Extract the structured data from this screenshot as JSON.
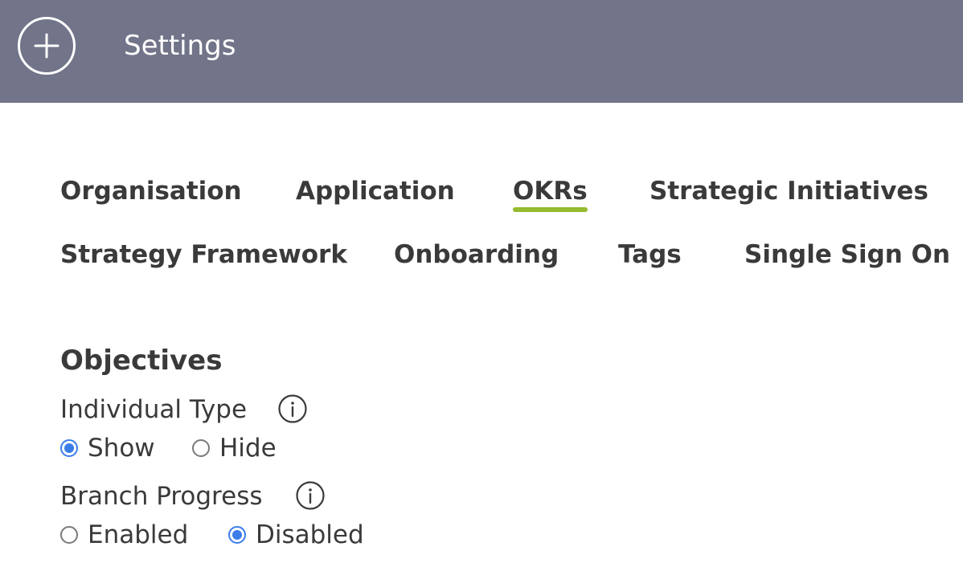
{
  "header": {
    "title": "Settings",
    "add_icon": "plus-circle-icon",
    "background": "#727489"
  },
  "tabs": [
    {
      "label": "Organisation",
      "active": false
    },
    {
      "label": "Application",
      "active": false
    },
    {
      "label": "OKRs",
      "active": true
    },
    {
      "label": "Strategic Initiatives",
      "active": false
    },
    {
      "label": "Strategy Framework",
      "active": false
    },
    {
      "label": "Onboarding",
      "active": false
    },
    {
      "label": "Tags",
      "active": false
    },
    {
      "label": "Single Sign On",
      "active": false
    }
  ],
  "active_tab_color": "#95bb2e",
  "section": {
    "title": "Objectives",
    "settings": [
      {
        "label": "Individual Type",
        "info_icon": "info-icon",
        "options": [
          {
            "label": "Show",
            "checked": true
          },
          {
            "label": "Hide",
            "checked": false
          }
        ]
      },
      {
        "label": "Branch Progress",
        "info_icon": "info-icon",
        "options": [
          {
            "label": "Enabled",
            "checked": false
          },
          {
            "label": "Disabled",
            "checked": true
          }
        ]
      }
    ]
  },
  "radio_color": "#3b7de9"
}
